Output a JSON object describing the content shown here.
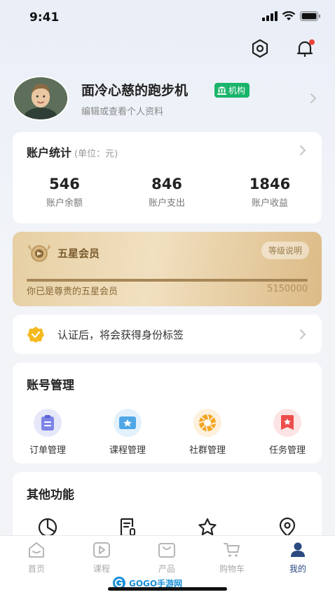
{
  "status_bar": {
    "time": "9:41"
  },
  "profile": {
    "name": "面冷心慈的跑步机",
    "badge": "机构",
    "edit_text": "编辑或查看个人资料"
  },
  "stats": {
    "title": "账户统计",
    "unit": "(单位：元)",
    "items": [
      {
        "value": "546",
        "label": "账户余额"
      },
      {
        "value": "846",
        "label": "账户支出"
      },
      {
        "value": "1846",
        "label": "账户收益"
      }
    ]
  },
  "member": {
    "title": "五星会员",
    "level_button": "等级说明",
    "description": "你已是尊贵的五星会员",
    "points": "5150000",
    "progress": 1.0
  },
  "verify": {
    "text": "认证后，将会获得身份标签"
  },
  "account_mgmt": {
    "title": "账号管理",
    "items": [
      {
        "label": "订单管理",
        "icon": "order-icon"
      },
      {
        "label": "课程管理",
        "icon": "course-icon"
      },
      {
        "label": "社群管理",
        "icon": "community-icon"
      },
      {
        "label": "任务管理",
        "icon": "task-icon"
      }
    ]
  },
  "others": {
    "title": "其他功能",
    "items": [
      {
        "icon": "pie-chart-icon"
      },
      {
        "icon": "document-icon"
      },
      {
        "icon": "star-icon"
      },
      {
        "icon": "location-icon"
      }
    ]
  },
  "tabbar": {
    "items": [
      {
        "label": "首页",
        "icon": "home-icon",
        "active": false
      },
      {
        "label": "课程",
        "icon": "play-icon",
        "active": false
      },
      {
        "label": "产品",
        "icon": "bag-icon",
        "active": false
      },
      {
        "label": "购物车",
        "icon": "cart-icon",
        "active": false
      },
      {
        "label": "我的",
        "icon": "user-icon",
        "active": true
      }
    ]
  },
  "watermark": {
    "text": "GOGO手游网"
  },
  "colors": {
    "badge_green": "#19b46a",
    "tab_active": "#2a4a80",
    "member_gold": "#e6cfa3"
  }
}
